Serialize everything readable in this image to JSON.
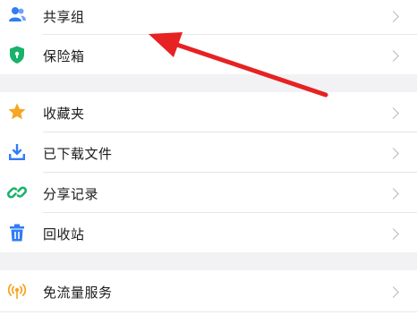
{
  "menu": {
    "items": [
      {
        "label": "共享组",
        "icon": "people-icon",
        "color": "#2f7cf6"
      },
      {
        "label": "保险箱",
        "icon": "shield-icon",
        "color": "#19b26b"
      },
      {
        "label": "收藏夹",
        "icon": "star-icon",
        "color": "#f5a623"
      },
      {
        "label": "已下载文件",
        "icon": "download-icon",
        "color": "#2f7cf6"
      },
      {
        "label": "分享记录",
        "icon": "link-icon",
        "color": "#19b26b"
      },
      {
        "label": "回收站",
        "icon": "trash-icon",
        "color": "#2f7cf6"
      },
      {
        "label": "免流量服务",
        "icon": "signal-icon",
        "color": "#f5a623"
      }
    ]
  },
  "annotation": {
    "arrow_color": "#e62222",
    "points_to": "共享组"
  }
}
